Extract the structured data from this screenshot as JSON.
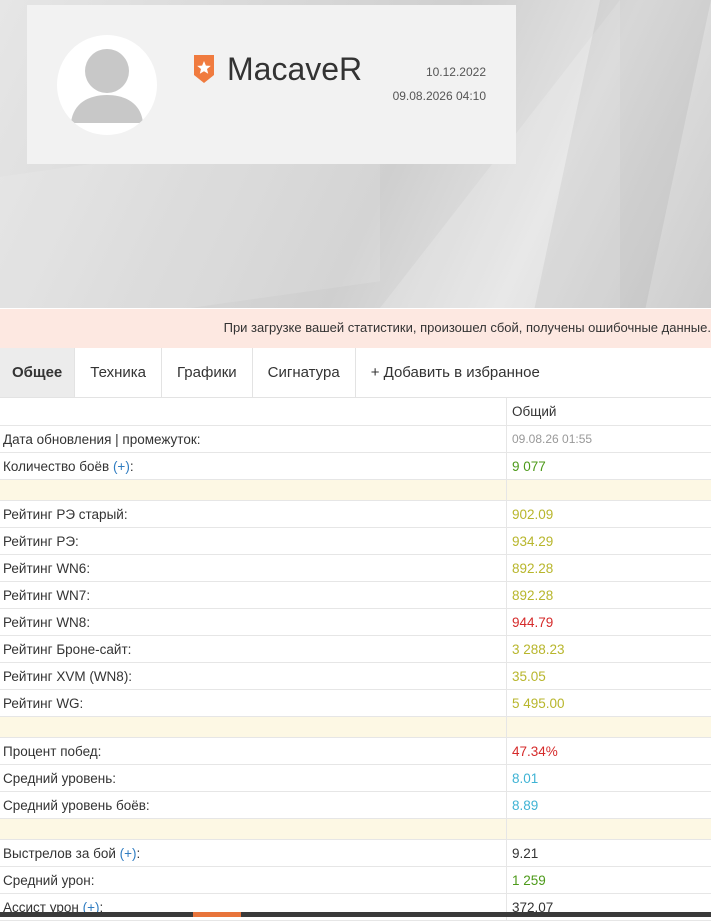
{
  "profile": {
    "username": "MacaveR",
    "registration_date": "10.12.2022",
    "last_update": "09.08.2026 04:10",
    "badge_color": "#f07b3f"
  },
  "alert": {
    "text": "При загрузке вашей статистики, произошел сбой, получены ошибочные данные."
  },
  "tabs": [
    {
      "label": "Общее",
      "active": true
    },
    {
      "label": "Техника"
    },
    {
      "label": "Графики"
    },
    {
      "label": "Сигнатура"
    },
    {
      "label": "+ Добавить в избранное"
    }
  ],
  "stats": {
    "column_header": "Общий",
    "plus_label": "(+)",
    "rows": {
      "update": {
        "label": "Дата обновления | промежуток:",
        "value": "09.08.26 01:55"
      },
      "battles": {
        "label": "Количество боёв",
        "value": "9 077"
      },
      "rating_re_old": {
        "label": "Рейтинг РЭ старый:",
        "value": "902.09"
      },
      "rating_re": {
        "label": "Рейтинг РЭ:",
        "value": "934.29"
      },
      "rating_wn6": {
        "label": "Рейтинг WN6:",
        "value": "892.28"
      },
      "rating_wn7": {
        "label": "Рейтинг WN7:",
        "value": "892.28"
      },
      "rating_wn8": {
        "label": "Рейтинг WN8:",
        "value": "944.79"
      },
      "rating_brone": {
        "label": "Рейтинг Броне-сайт:",
        "value": "3 288.23"
      },
      "rating_xvm": {
        "label": "Рейтинг XVM (WN8):",
        "value": "35.05"
      },
      "rating_wg": {
        "label": "Рейтинг WG:",
        "value": "5 495.00"
      },
      "win_rate": {
        "label": "Процент побед:",
        "value": "47.34%"
      },
      "avg_tier": {
        "label": "Средний уровень:",
        "value": "8.01"
      },
      "avg_battle_tier": {
        "label": "Средний уровень боёв:",
        "value": "8.89"
      },
      "shots": {
        "label": "Выстрелов за бой",
        "value": "9.21"
      },
      "avg_damage": {
        "label": "Средний урон:",
        "value": "1 259"
      },
      "assist": {
        "label": "Ассист урон",
        "value": "372.07"
      }
    }
  },
  "colors": {
    "green": "#4d9a1a",
    "yellow": "#b8b62c",
    "red": "#d52a2a",
    "cyan": "#3fb3d4",
    "link": "#2f7cc1",
    "alert_bg": "#fde8e1",
    "separator_bg": "#fdf8e4"
  }
}
